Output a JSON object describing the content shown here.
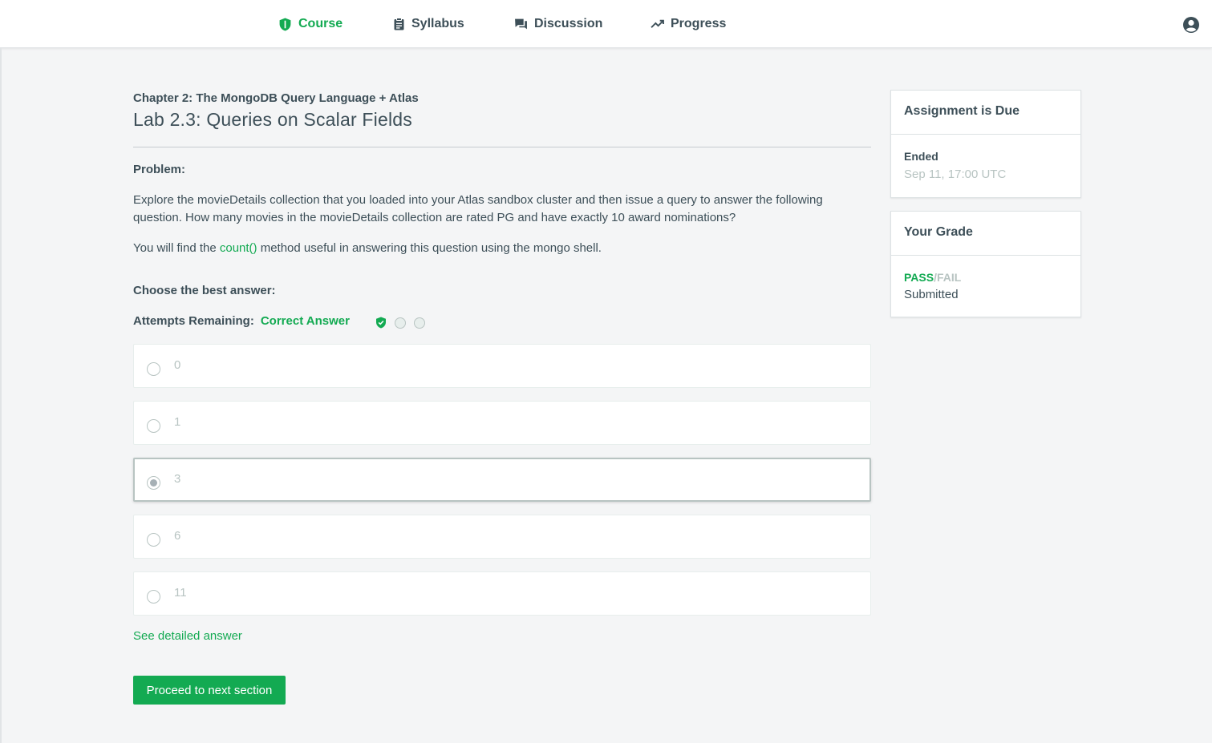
{
  "nav": {
    "items": [
      {
        "label": "Course",
        "icon": "shield-icon",
        "active": true
      },
      {
        "label": "Syllabus",
        "icon": "clipboard-icon",
        "active": false
      },
      {
        "label": "Discussion",
        "icon": "chat-icon",
        "active": false
      },
      {
        "label": "Progress",
        "icon": "trending-up-icon",
        "active": false
      }
    ],
    "user_icon": "user-account-icon"
  },
  "content": {
    "chapter": "Chapter 2: The MongoDB Query Language + Atlas",
    "title": "Lab 2.3: Queries on Scalar Fields",
    "problem_label": "Problem:",
    "problem_text": "Explore the movieDetails collection that you loaded into your Atlas sandbox cluster and then issue a query to answer the following question. How many movies in the movieDetails collection are rated PG and have exactly 10 award nominations?",
    "hint_before": "You will find the ",
    "hint_code": "count()",
    "hint_after": " method useful in answering this question using the mongo shell.",
    "choose_label": "Choose the best answer:",
    "attempts_label": "Attempts Remaining:",
    "attempts_status": "Correct Answer",
    "attempt_indicators": [
      "check-shield-icon",
      "empty-dot",
      "empty-dot"
    ],
    "options": [
      "0",
      "1",
      "3",
      "6",
      "11"
    ],
    "selected_option": "3",
    "detailed_answer_link": "See detailed answer",
    "proceed_button": "Proceed to next section"
  },
  "sidebar": {
    "due_card": {
      "title": "Assignment is Due",
      "status": "Ended",
      "date": "Sep 11, 17:00 UTC"
    },
    "grade_card": {
      "title": "Your Grade",
      "pass": "PASS",
      "separator": "/",
      "fail": "FAIL",
      "status": "Submitted"
    }
  },
  "colors": {
    "accent": "#13aa52",
    "text": "#3d4f58",
    "muted": "#b8c4c2",
    "background": "#f4f5f6"
  }
}
